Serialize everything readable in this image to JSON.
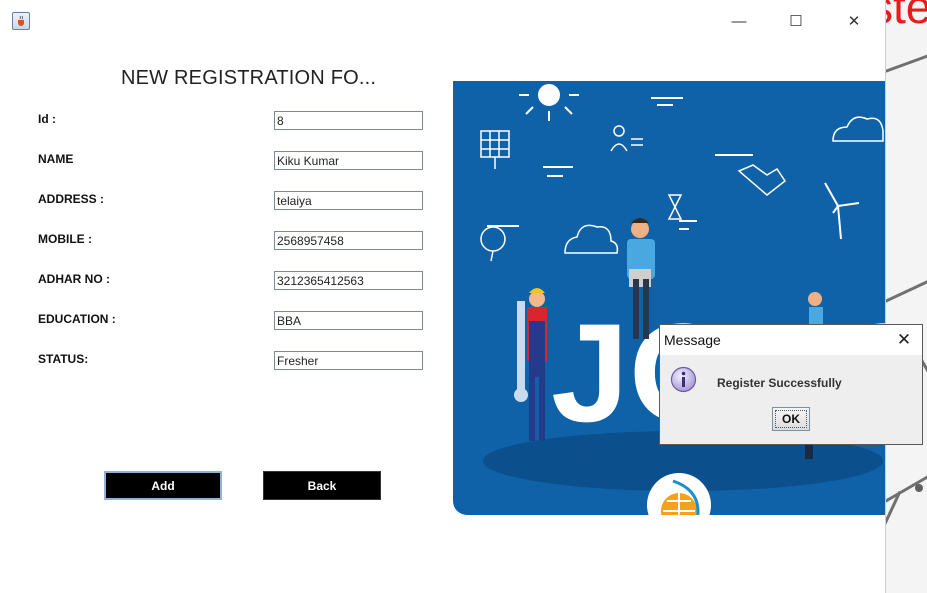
{
  "window": {
    "icon": "java-icon",
    "controls": {
      "minimize": "—",
      "maximize": "☐",
      "close": "✕"
    }
  },
  "form": {
    "title": "NEW REGISTRATION FO...",
    "fields": [
      {
        "label": "Id :",
        "value": "8"
      },
      {
        "label": "NAME",
        "value": "Kiku Kumar"
      },
      {
        "label": "ADDRESS :",
        "value": "telaiya"
      },
      {
        "label": "MOBILE :",
        "value": "2568957458"
      },
      {
        "label": "ADHAR NO :",
        "value": "3212365412563"
      },
      {
        "label": "EDUCATION :",
        "value": "BBA"
      },
      {
        "label": "STATUS:",
        "value": "Fresher"
      }
    ],
    "buttons": {
      "add": "Add",
      "back": "Back"
    }
  },
  "image": {
    "text": "JOBS"
  },
  "background": {
    "red_text": "ste"
  },
  "dialog": {
    "title": "Message",
    "close": "✕",
    "icon": "info-icon",
    "message": "Register Successfully",
    "ok_label": "OK"
  },
  "colors": {
    "button_bg": "#000000",
    "image_bg": "#0f62a8",
    "dialog_bg": "#eeeeee",
    "accent_red": "#e81c1c"
  }
}
